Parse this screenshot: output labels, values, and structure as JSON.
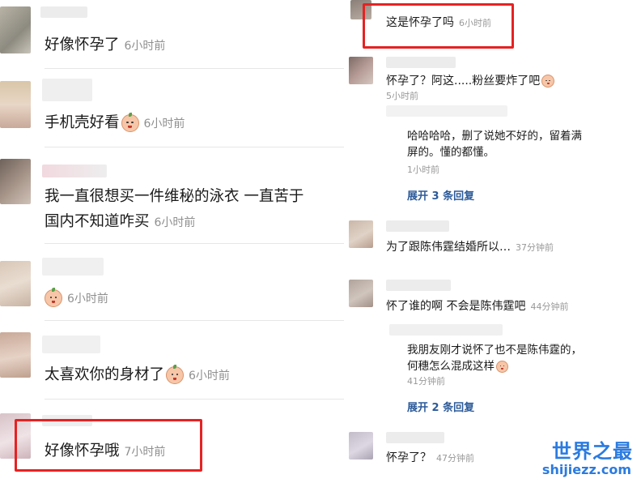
{
  "left": {
    "comments": [
      {
        "text": "好像怀孕了",
        "time": "6小时前"
      },
      {
        "text": "手机壳好看",
        "time": "6小时前"
      },
      {
        "text_line1": "我一直很想买一件维秘的泳衣 一直苦于",
        "text_line2": "国内不知道咋买",
        "time": "6小时前"
      },
      {
        "text": "",
        "time": "6小时前"
      },
      {
        "text": "太喜欢你的身材了",
        "time": "6小时前"
      },
      {
        "text": "好像怀孕哦",
        "time": "7小时前"
      }
    ]
  },
  "right": {
    "comments": [
      {
        "text": "这是怀孕了吗",
        "time": "6小时前"
      },
      {
        "text": "怀孕了？阿这.....粉丝要炸了吧",
        "time": "5小时前",
        "reply_line1": "哈哈哈哈，删了说她不好的，留着满",
        "reply_line2": "屏的。懂的都懂。",
        "reply_time": "1小时前",
        "expand": "展开 3 条回复"
      },
      {
        "text": "为了跟陈伟霆结婚所以…",
        "time": "37分钟前"
      },
      {
        "text": "怀了谁的啊 不会是陈伟霆吧",
        "time": "44分钟前",
        "reply_line1": "我朋友刚才说怀了也不是陈伟霆的，",
        "reply_line2": "何穗怎么混成这样",
        "reply_time": "41分钟前",
        "expand": "展开 2 条回复"
      },
      {
        "text": "怀孕了？",
        "time": "47分钟前"
      }
    ]
  },
  "watermark": {
    "title": "世界之最",
    "url": "shijiezz.com"
  },
  "colors": {
    "highlight": "#e62222",
    "link": "#2c5a99",
    "watermark": "#2b7be0"
  }
}
